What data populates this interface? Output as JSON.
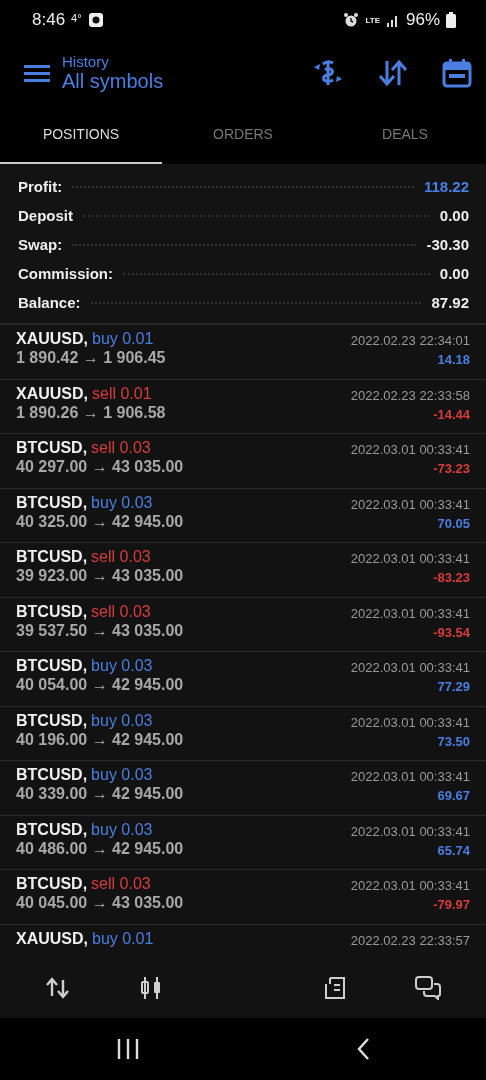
{
  "status_bar": {
    "time": "8:46",
    "temperature": "4°",
    "network": "LTE",
    "battery": "96%"
  },
  "header": {
    "subtitle": "History",
    "title": "All symbols"
  },
  "tabs": [
    {
      "label": "POSITIONS",
      "selected": true
    },
    {
      "label": "ORDERS",
      "selected": false
    },
    {
      "label": "DEALS",
      "selected": false
    }
  ],
  "summary": [
    {
      "label": "Profit:",
      "value": "118.22",
      "highlighted": true
    },
    {
      "label": "Deposit",
      "value": "0.00",
      "highlighted": false
    },
    {
      "label": "Swap:",
      "value": "-30.30",
      "highlighted": false
    },
    {
      "label": "Commission:",
      "value": "0.00",
      "highlighted": false
    },
    {
      "label": "Balance:",
      "value": "87.92",
      "highlighted": false
    }
  ],
  "positions": [
    {
      "symbol": "XAUUSD,",
      "trade": "buy 0.01",
      "kind": "buy",
      "prices": "1 890.42 → 1 906.45",
      "time": "2022.02.23 22:34:01",
      "profit": "14.18",
      "loss": false
    },
    {
      "symbol": "XAUUSD,",
      "trade": "sell 0.01",
      "kind": "sell",
      "prices": "1 890.26 → 1 906.58",
      "time": "2022.02.23 22:33:58",
      "profit": "-14.44",
      "loss": true
    },
    {
      "symbol": "BTCUSD,",
      "trade": "sell 0.03",
      "kind": "sell",
      "prices": "40 297.00 → 43 035.00",
      "time": "2022.03.01 00:33:41",
      "profit": "-73.23",
      "loss": true
    },
    {
      "symbol": "BTCUSD,",
      "trade": "buy 0.03",
      "kind": "buy",
      "prices": "40 325.00 → 42 945.00",
      "time": "2022.03.01 00:33:41",
      "profit": "70.05",
      "loss": false
    },
    {
      "symbol": "BTCUSD,",
      "trade": "sell 0.03",
      "kind": "sell",
      "prices": "39 923.00 → 43 035.00",
      "time": "2022.03.01 00:33:41",
      "profit": "-83.23",
      "loss": true
    },
    {
      "symbol": "BTCUSD,",
      "trade": "sell 0.03",
      "kind": "sell",
      "prices": "39 537.50 → 43 035.00",
      "time": "2022.03.01 00:33:41",
      "profit": "-93.54",
      "loss": true
    },
    {
      "symbol": "BTCUSD,",
      "trade": "buy 0.03",
      "kind": "buy",
      "prices": "40 054.00 → 42 945.00",
      "time": "2022.03.01 00:33:41",
      "profit": "77.29",
      "loss": false
    },
    {
      "symbol": "BTCUSD,",
      "trade": "buy 0.03",
      "kind": "buy",
      "prices": "40 196.00 → 42 945.00",
      "time": "2022.03.01 00:33:41",
      "profit": "73.50",
      "loss": false
    },
    {
      "symbol": "BTCUSD,",
      "trade": "buy 0.03",
      "kind": "buy",
      "prices": "40 339.00 → 42 945.00",
      "time": "2022.03.01 00:33:41",
      "profit": "69.67",
      "loss": false
    },
    {
      "symbol": "BTCUSD,",
      "trade": "buy 0.03",
      "kind": "buy",
      "prices": "40 486.00 → 42 945.00",
      "time": "2022.03.01 00:33:41",
      "profit": "65.74",
      "loss": false
    },
    {
      "symbol": "BTCUSD,",
      "trade": "sell 0.03",
      "kind": "sell",
      "prices": "40 045.00 → 43 035.00",
      "time": "2022.03.01 00:33:41",
      "profit": "-79.97",
      "loss": true
    },
    {
      "symbol": "XAUUSD,",
      "trade": "buy 0.01",
      "kind": "buy",
      "time": "2022.02.23 22:33:57"
    }
  ]
}
